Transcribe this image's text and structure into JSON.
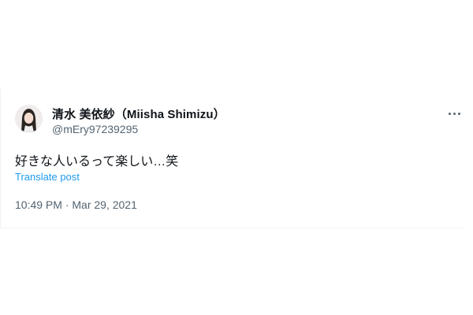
{
  "tweet": {
    "author": {
      "display_name": "清水 美依紗（Miisha Shimizu）",
      "handle": "@mEry97239295",
      "avatar": "avatar-photo"
    },
    "more_icon": "more-horizontal-icon",
    "text": "好きな人いるって楽しい…笑",
    "translate_label": "Translate post",
    "timestamp": "10:49 PM · Mar 29, 2021"
  },
  "colors": {
    "text_primary": "#0f1419",
    "text_secondary": "#536471",
    "link": "#1d9bf0",
    "divider": "#eff3f4"
  }
}
